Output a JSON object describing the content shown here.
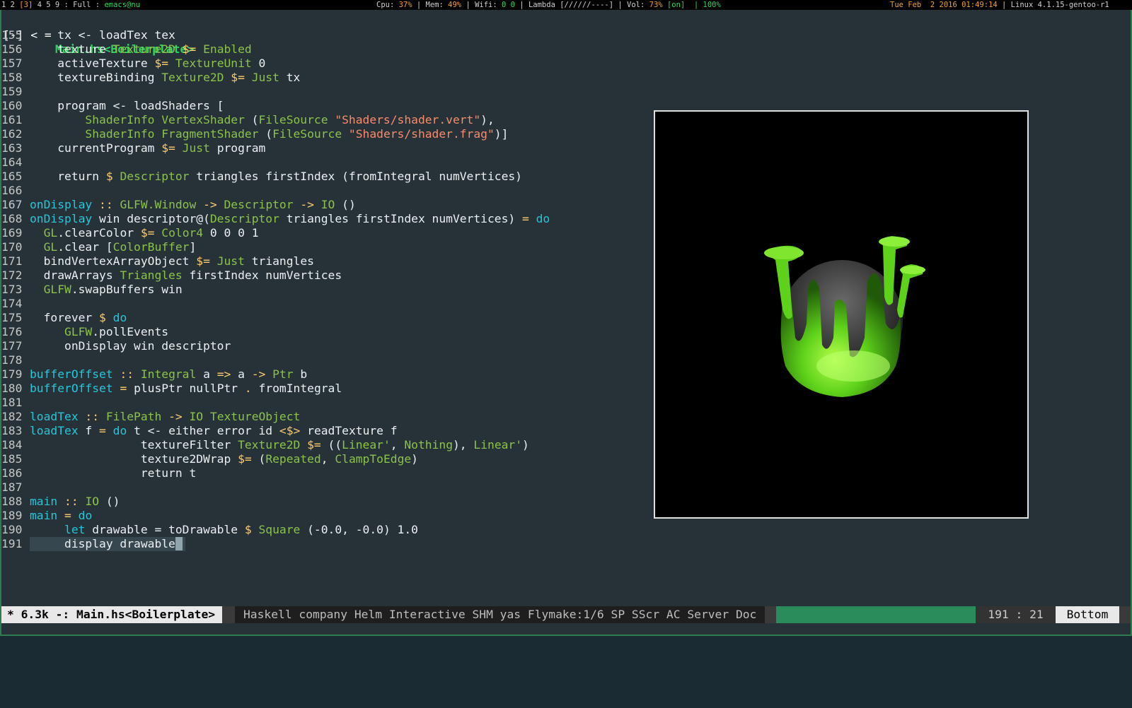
{
  "topbar": {
    "workspaces_pre": "1 2 ",
    "workspace_active": "[3]",
    "workspaces_post": " 4 5 9 : ",
    "layout": "Full",
    "sep1": " : ",
    "window": "emacs@nu",
    "cpu_label": "Cpu: ",
    "cpu_value": "37%",
    "mem_label": " | Mem: ",
    "mem_value": "49%",
    "wifi_label": " | Wifi: ",
    "wifi_value": "0 0",
    "lambda": " | Lambda [//////----] | Vol: ",
    "vol_value": "73%",
    "vol_state": " [on]",
    "brightness": "  | 100%",
    "datetime": "Tue Feb  2 2016 01:49:14",
    "kernel": " | Linux 4.1.15-gentoo-r1"
  },
  "header": {
    "bracket": "[-] < =",
    "title": "Main.hs<Boilerplate>"
  },
  "code_lines": [
    {
      "n": "155",
      "t": [
        [
          "",
          "    tx <- loadTex tex"
        ]
      ]
    },
    {
      "n": "156",
      "t": [
        [
          "",
          "    texture "
        ],
        [
          "ty",
          "Texture2D"
        ],
        [
          "op",
          " $= "
        ],
        [
          "ty",
          "Enabled"
        ]
      ]
    },
    {
      "n": "157",
      "t": [
        [
          "",
          "    activeTexture "
        ],
        [
          "op",
          "$= "
        ],
        [
          "ty",
          "TextureUnit"
        ],
        [
          "",
          " 0"
        ]
      ]
    },
    {
      "n": "158",
      "t": [
        [
          "",
          "    textureBinding "
        ],
        [
          "ty",
          "Texture2D"
        ],
        [
          "op",
          " $= "
        ],
        [
          "ty",
          "Just"
        ],
        [
          "",
          " tx"
        ]
      ]
    },
    {
      "n": "159",
      "t": [
        [
          "",
          ""
        ]
      ]
    },
    {
      "n": "160",
      "t": [
        [
          "",
          "    program <- loadShaders ["
        ]
      ]
    },
    {
      "n": "161",
      "t": [
        [
          "",
          "        "
        ],
        [
          "ty",
          "ShaderInfo VertexShader"
        ],
        [
          "",
          " ("
        ],
        [
          "ty",
          "FileSource"
        ],
        [
          "st",
          " \"Shaders/shader.vert\""
        ],
        [
          "",
          "),"
        ]
      ]
    },
    {
      "n": "162",
      "t": [
        [
          "",
          "        "
        ],
        [
          "ty",
          "ShaderInfo FragmentShader"
        ],
        [
          "",
          " ("
        ],
        [
          "ty",
          "FileSource"
        ],
        [
          "st",
          " \"Shaders/shader.frag\""
        ],
        [
          "",
          ")]"
        ]
      ]
    },
    {
      "n": "163",
      "t": [
        [
          "",
          "    currentProgram "
        ],
        [
          "op",
          "$= "
        ],
        [
          "ty",
          "Just"
        ],
        [
          "",
          " program"
        ]
      ]
    },
    {
      "n": "164",
      "t": [
        [
          "",
          ""
        ]
      ]
    },
    {
      "n": "165",
      "t": [
        [
          "",
          "    return "
        ],
        [
          "op",
          "$ "
        ],
        [
          "ty",
          "Descriptor"
        ],
        [
          "",
          " triangles firstIndex (fromIntegral numVertices)"
        ]
      ]
    },
    {
      "n": "166",
      "t": [
        [
          "",
          ""
        ]
      ]
    },
    {
      "n": "167",
      "t": [
        [
          "kw",
          "onDisplay"
        ],
        [
          "op",
          " :: "
        ],
        [
          "ty",
          "GLFW.Window"
        ],
        [
          "op",
          " -> "
        ],
        [
          "ty",
          "Descriptor"
        ],
        [
          "op",
          " -> "
        ],
        [
          "ty",
          "IO"
        ],
        [
          "",
          " ()"
        ]
      ]
    },
    {
      "n": "168",
      "t": [
        [
          "kw",
          "onDisplay"
        ],
        [
          "",
          " win descriptor@("
        ],
        [
          "ty",
          "Descriptor"
        ],
        [
          "",
          " triangles firstIndex numVertices) "
        ],
        [
          "op",
          "="
        ],
        [
          "kw",
          " do"
        ]
      ]
    },
    {
      "n": "169",
      "t": [
        [
          "ty",
          "  GL"
        ],
        [
          "",
          ".clearColor "
        ],
        [
          "op",
          "$= "
        ],
        [
          "ty",
          "Color4"
        ],
        [
          "",
          " 0 0 0 1"
        ]
      ]
    },
    {
      "n": "170",
      "t": [
        [
          "ty",
          "  GL"
        ],
        [
          "",
          ".clear ["
        ],
        [
          "ty",
          "ColorBuffer"
        ],
        [
          "",
          "]"
        ]
      ]
    },
    {
      "n": "171",
      "t": [
        [
          "",
          "  bindVertexArrayObject "
        ],
        [
          "op",
          "$= "
        ],
        [
          "ty",
          "Just"
        ],
        [
          "",
          " triangles"
        ]
      ]
    },
    {
      "n": "172",
      "t": [
        [
          "",
          "  drawArrays "
        ],
        [
          "ty",
          "Triangles"
        ],
        [
          "",
          " firstIndex numVertices"
        ]
      ]
    },
    {
      "n": "173",
      "t": [
        [
          "ty",
          "  GLFW"
        ],
        [
          "",
          ".swapBuffers win"
        ]
      ]
    },
    {
      "n": "174",
      "t": [
        [
          "",
          ""
        ]
      ]
    },
    {
      "n": "175",
      "t": [
        [
          "",
          "  forever "
        ],
        [
          "op",
          "$ "
        ],
        [
          "kw",
          "do"
        ]
      ]
    },
    {
      "n": "176",
      "t": [
        [
          "ty",
          "     GLFW"
        ],
        [
          "",
          ".pollEvents"
        ]
      ]
    },
    {
      "n": "177",
      "t": [
        [
          "",
          "     onDisplay win descriptor"
        ]
      ]
    },
    {
      "n": "178",
      "t": [
        [
          "",
          ""
        ]
      ]
    },
    {
      "n": "179",
      "t": [
        [
          "kw",
          "bufferOffset"
        ],
        [
          "op",
          " :: "
        ],
        [
          "ty",
          "Integral"
        ],
        [
          "",
          " a "
        ],
        [
          "op",
          "=>"
        ],
        [
          "",
          " a "
        ],
        [
          "op",
          "->"
        ],
        [
          "ty",
          " Ptr"
        ],
        [
          "",
          " b"
        ]
      ]
    },
    {
      "n": "180",
      "t": [
        [
          "kw",
          "bufferOffset"
        ],
        [
          "op",
          " = "
        ],
        [
          "",
          "plusPtr nullPtr "
        ],
        [
          "op",
          "."
        ],
        [
          "",
          " fromIntegral"
        ]
      ]
    },
    {
      "n": "181",
      "t": [
        [
          "",
          ""
        ]
      ]
    },
    {
      "n": "182",
      "t": [
        [
          "kw",
          "loadTex"
        ],
        [
          "op",
          " :: "
        ],
        [
          "ty",
          "FilePath"
        ],
        [
          "op",
          " -> "
        ],
        [
          "ty",
          "IO TextureObject"
        ]
      ]
    },
    {
      "n": "183",
      "t": [
        [
          "kw",
          "loadTex"
        ],
        [
          "",
          " f "
        ],
        [
          "op",
          "= "
        ],
        [
          "kw",
          "do"
        ],
        [
          "",
          " t <- either error id "
        ],
        [
          "op",
          "<$>"
        ],
        [
          "",
          " readTexture f"
        ]
      ]
    },
    {
      "n": "184",
      "t": [
        [
          "",
          "                textureFilter "
        ],
        [
          "ty",
          "Texture2D"
        ],
        [
          "op",
          " $= "
        ],
        [
          "",
          "(("
        ],
        [
          "ty",
          "Linear'"
        ],
        [
          "",
          ", "
        ],
        [
          "ty",
          "Nothing"
        ],
        [
          "",
          "), "
        ],
        [
          "ty",
          "Linear'"
        ],
        [
          "",
          ")"
        ]
      ]
    },
    {
      "n": "185",
      "t": [
        [
          "",
          "                texture2DWrap "
        ],
        [
          "op",
          "$= "
        ],
        [
          "",
          "("
        ],
        [
          "ty",
          "Repeated"
        ],
        [
          "",
          ", "
        ],
        [
          "ty",
          "ClampToEdge"
        ],
        [
          "",
          ")"
        ]
      ]
    },
    {
      "n": "186",
      "t": [
        [
          "",
          "                return t"
        ]
      ]
    },
    {
      "n": "187",
      "t": [
        [
          "",
          ""
        ]
      ]
    },
    {
      "n": "188",
      "t": [
        [
          "kw",
          "main"
        ],
        [
          "op",
          " :: "
        ],
        [
          "ty",
          "IO"
        ],
        [
          "",
          " ()"
        ]
      ]
    },
    {
      "n": "189",
      "t": [
        [
          "kw",
          "main"
        ],
        [
          "op",
          " = "
        ],
        [
          "kw",
          "do"
        ]
      ]
    },
    {
      "n": "190",
      "t": [
        [
          "kw",
          "     let"
        ],
        [
          "",
          " drawable = toDrawable "
        ],
        [
          "op",
          "$ "
        ],
        [
          "ty",
          "Square"
        ],
        [
          "",
          " (-0.0, -0.0) 1.0"
        ]
      ]
    },
    {
      "n": "191",
      "t": [
        [
          "",
          "     display drawable"
        ]
      ]
    }
  ],
  "modeline": {
    "left": "* 6.3k -: Main.hs<Boilerplate>",
    "modes": "Haskell company Helm Interactive SHM yas Flymake:1/6 SP SScr AC Server Doc",
    "position": "191 : 21",
    "scroll": "Bottom"
  },
  "colors": {
    "background": "#263238",
    "keyword": "#26c6da",
    "type": "#8bc34a",
    "operator": "#ffcb6b",
    "string": "#f78c6c",
    "accent": "#2a8c5a"
  },
  "gl_window": {
    "icon": "green-slime-sphere-icon"
  }
}
